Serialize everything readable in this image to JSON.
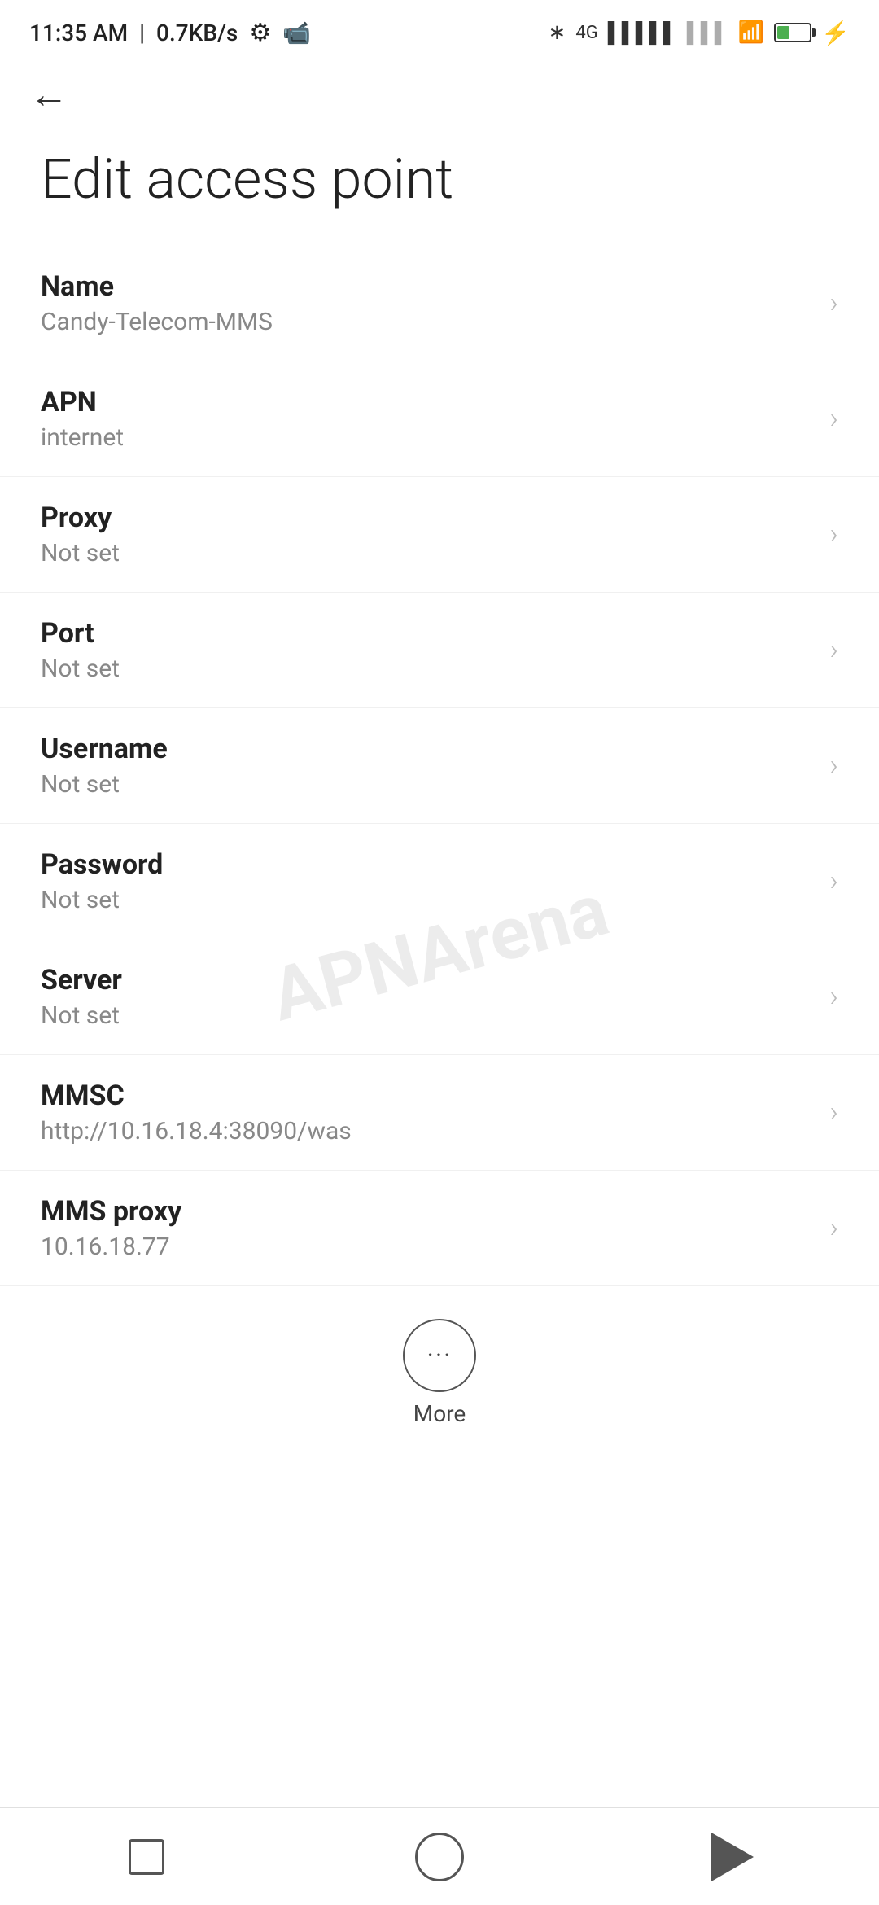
{
  "statusBar": {
    "time": "11:35 AM",
    "speed": "0.7KB/s",
    "batteryPercent": "38"
  },
  "nav": {
    "backLabel": "←"
  },
  "page": {
    "title": "Edit access point"
  },
  "settings": [
    {
      "id": "name",
      "label": "Name",
      "value": "Candy-Telecom-MMS"
    },
    {
      "id": "apn",
      "label": "APN",
      "value": "internet"
    },
    {
      "id": "proxy",
      "label": "Proxy",
      "value": "Not set"
    },
    {
      "id": "port",
      "label": "Port",
      "value": "Not set"
    },
    {
      "id": "username",
      "label": "Username",
      "value": "Not set"
    },
    {
      "id": "password",
      "label": "Password",
      "value": "Not set"
    },
    {
      "id": "server",
      "label": "Server",
      "value": "Not set"
    },
    {
      "id": "mmsc",
      "label": "MMSC",
      "value": "http://10.16.18.4:38090/was"
    },
    {
      "id": "mms-proxy",
      "label": "MMS proxy",
      "value": "10.16.18.77"
    }
  ],
  "more": {
    "label": "More",
    "dots": "···"
  },
  "watermark": "APNArena"
}
